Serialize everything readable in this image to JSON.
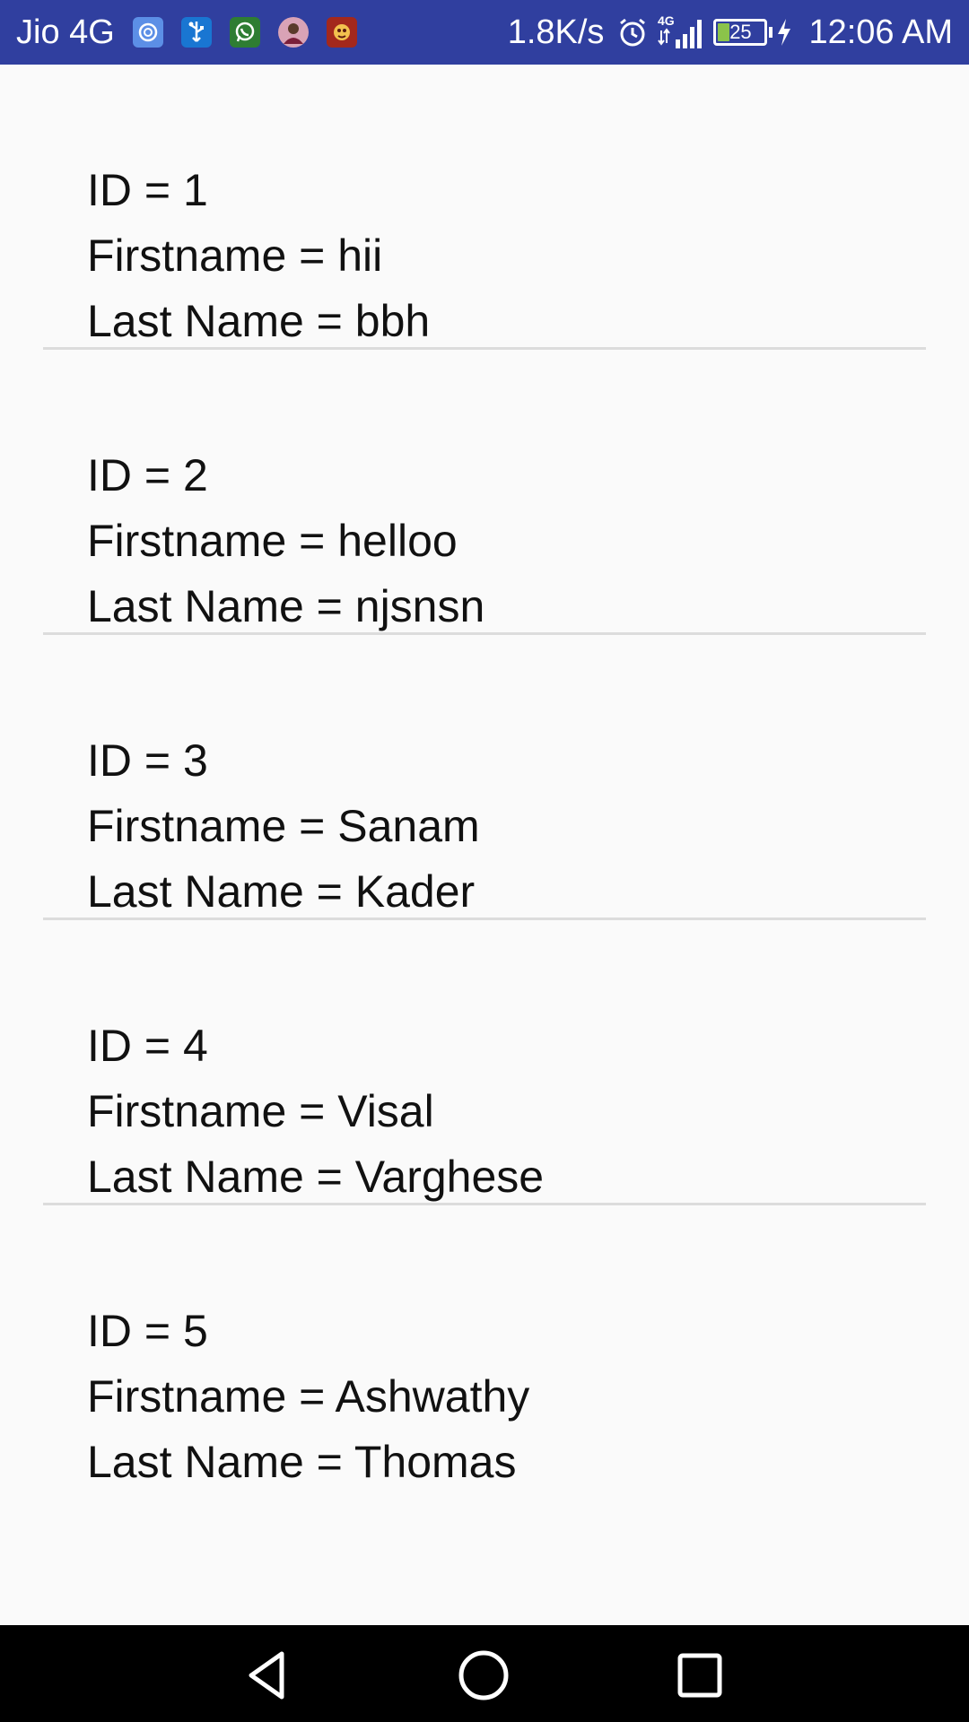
{
  "status_bar": {
    "carrier": "Jio 4G",
    "network_speed": "1.8K/s",
    "network_type": "4G",
    "battery_level": "25",
    "battery_fraction": 0.25,
    "time": "12:06 AM",
    "notification_icons": [
      "vpn-icon",
      "usb-icon",
      "whatsapp-icon",
      "contact-avatar-icon",
      "game-icon"
    ],
    "status_icons": [
      "alarm-icon",
      "signal-icon",
      "battery-icon",
      "charging-icon"
    ],
    "background_color": "#303f9f"
  },
  "records": [
    {
      "id": "ID = 1",
      "firstname": "Firstname = hii",
      "lastname": "Last Name = bbh"
    },
    {
      "id": "ID = 2",
      "firstname": "Firstname = helloo",
      "lastname": "Last Name = njsnsn"
    },
    {
      "id": "ID = 3",
      "firstname": "Firstname = Sanam",
      "lastname": "Last Name = Kader"
    },
    {
      "id": "ID = 4",
      "firstname": "Firstname = Visal",
      "lastname": "Last Name = Varghese"
    },
    {
      "id": "ID = 5",
      "firstname": "Firstname = Ashwathy",
      "lastname": "Last Name = Thomas"
    }
  ],
  "nav_bar": {
    "buttons": [
      "back-icon",
      "home-icon",
      "recents-icon"
    ]
  }
}
